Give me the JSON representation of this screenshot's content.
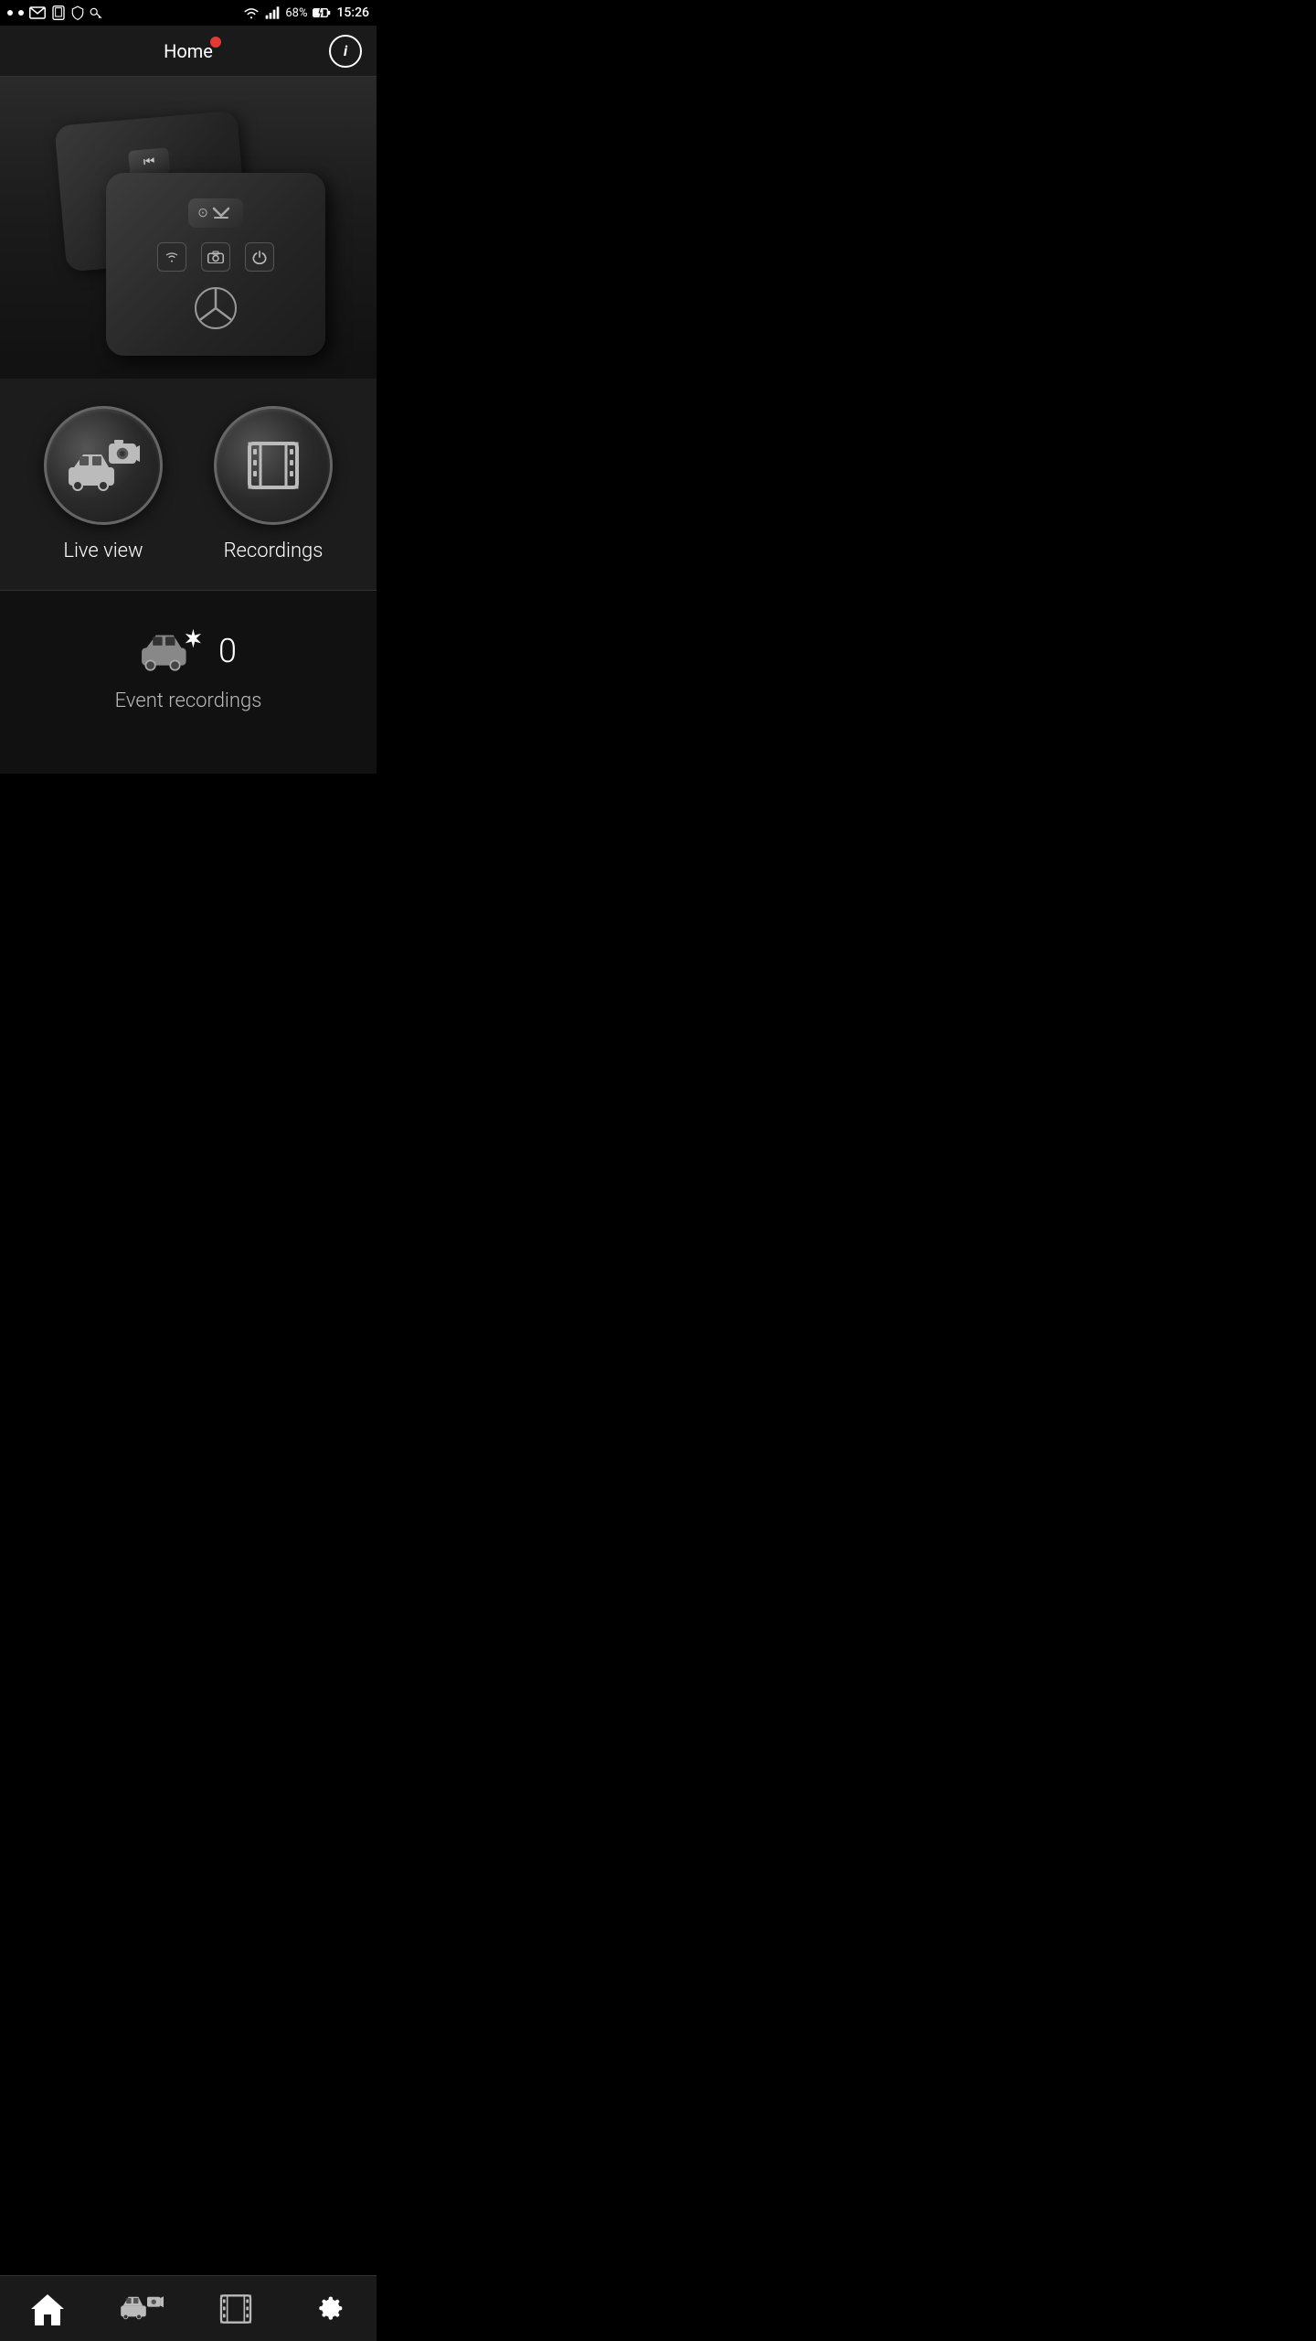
{
  "statusBar": {
    "battery": "68%",
    "time": "15:26",
    "icons": [
      "dots",
      "mail",
      "phone",
      "shield",
      "key"
    ]
  },
  "header": {
    "title": "Home",
    "infoButton": "i"
  },
  "hero": {
    "deviceAlt": "Mercedes dashcam device"
  },
  "actions": {
    "liveView": {
      "label": "Live view",
      "iconName": "live-view-icon"
    },
    "recordings": {
      "label": "Recordings",
      "iconName": "recordings-icon"
    }
  },
  "events": {
    "count": "0",
    "label": "Event recordings"
  },
  "bottomNav": {
    "home": "home-icon",
    "liveView": "live-view-nav-icon",
    "recordings": "recordings-nav-icon",
    "settings": "settings-nav-icon"
  }
}
